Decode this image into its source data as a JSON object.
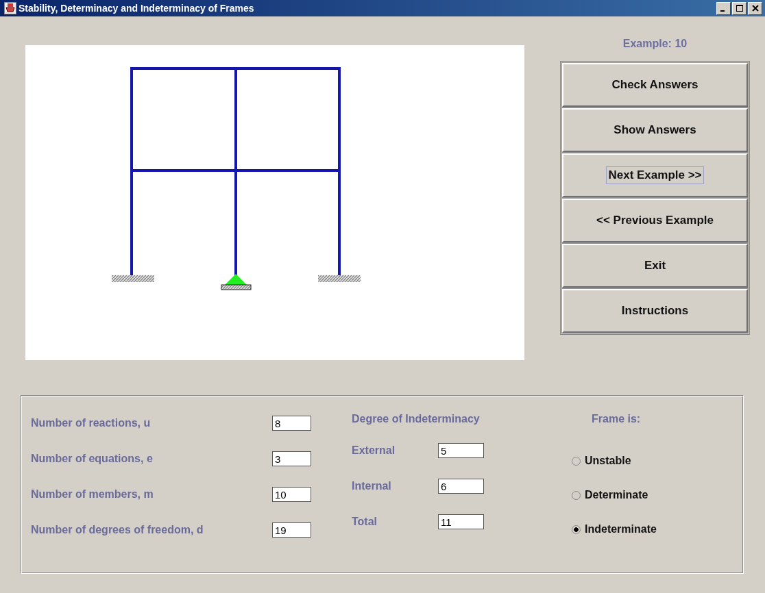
{
  "window": {
    "title": "Stability, Determinacy and Indeterminacy of Frames"
  },
  "example_label": "Example: 10",
  "buttons": [
    {
      "label": "Check Answers",
      "focused": false
    },
    {
      "label": "Show Answers",
      "focused": false
    },
    {
      "label": "Next Example >>",
      "focused": true
    },
    {
      "label": "<< Previous Example",
      "focused": false
    },
    {
      "label": "Exit",
      "focused": false
    },
    {
      "label": "Instructions",
      "focused": false
    }
  ],
  "counts": [
    {
      "label": "Number of reactions, u",
      "value": "8"
    },
    {
      "label": "Number of equations, e",
      "value": "3"
    },
    {
      "label": "Number of members, m",
      "value": "10"
    },
    {
      "label": "Number of degrees of freedom, d",
      "value": "19"
    }
  ],
  "indeterminacy": {
    "heading": "Degree of Indeterminacy",
    "fields": [
      {
        "label": "External",
        "value": "5"
      },
      {
        "label": "Internal",
        "value": "6"
      },
      {
        "label": "Total",
        "value": "11"
      }
    ]
  },
  "frame_is": {
    "heading": "Frame is:",
    "options": [
      {
        "label": "Unstable",
        "selected": false
      },
      {
        "label": "Determinate",
        "selected": false
      },
      {
        "label": "Indeterminate",
        "selected": true
      }
    ]
  }
}
